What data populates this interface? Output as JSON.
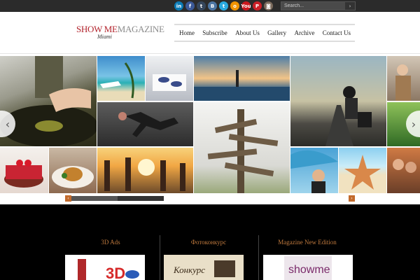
{
  "social": [
    {
      "name": "linkedin-icon",
      "glyph": "in",
      "color": "#0b7bb6"
    },
    {
      "name": "facebook-icon",
      "glyph": "f",
      "color": "#3b5998"
    },
    {
      "name": "tumblr-icon",
      "glyph": "t",
      "color": "#35465c"
    },
    {
      "name": "vk-icon",
      "glyph": "B",
      "color": "#4c75a3"
    },
    {
      "name": "twitter-icon",
      "glyph": "t",
      "color": "#2aa9e0"
    },
    {
      "name": "odnoklassniki-icon",
      "glyph": "o",
      "color": "#f29300"
    },
    {
      "name": "youtube-icon",
      "glyph": "You",
      "color": "#cc181e"
    },
    {
      "name": "pinterest-icon",
      "glyph": "P",
      "color": "#cb2027"
    },
    {
      "name": "instagram-icon",
      "glyph": "◙",
      "color": "#7a6a5c"
    }
  ],
  "search": {
    "placeholder": "Search...",
    "button": "›"
  },
  "logo": {
    "part1": "SHOW ME",
    "part2": "MAGAZINE",
    "sub": "Miami"
  },
  "nav": [
    "Home",
    "Subscribe",
    "About Us",
    "Gallery",
    "Archive",
    "Contact Us"
  ],
  "slider": {
    "prev": "‹",
    "next": "›",
    "progress": 0.5
  },
  "strip": {
    "prev": "‹",
    "next": "›"
  },
  "columns": [
    {
      "title": "3D Ads",
      "thumb_text": "3D"
    },
    {
      "title": "Фотоконкурс",
      "thumb_text": "Конкурс"
    },
    {
      "title": "Magazine New Edition",
      "thumb_text": "showme"
    }
  ]
}
